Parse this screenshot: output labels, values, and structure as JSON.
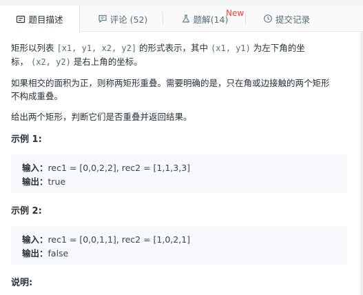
{
  "tabs": [
    {
      "label": "题目描述",
      "icon": "description-icon"
    },
    {
      "label": "评论 (52)",
      "icon": "comment-icon"
    },
    {
      "label": "题解(14)",
      "icon": "flask-icon"
    },
    {
      "label": "提交记录",
      "icon": "clock-icon"
    }
  ],
  "new_badge": "New",
  "problem": {
    "p1_a": "矩形以列表 ",
    "p1_code1": "[x1, y1, x2, y2]",
    "p1_b": " 的形式表示，其中 ",
    "p1_code2": "(x1, y1)",
    "p1_c": " 为左下角的坐",
    "p1_d": "标，",
    "p1_code3": "(x2, y2)",
    "p1_e": " 是右上角的坐标。",
    "p2_line1": "如果相交的面积为正，则称两矩形重叠。需要明确的是，只在角或边接触的两个矩形",
    "p2_line2": "不构成重叠。",
    "p3": "给出两个矩形，判断它们是否重叠并返回结果。"
  },
  "examples": [
    {
      "heading": "示例 1:",
      "input_label": "输入：",
      "input": "rec1 = [0,0,2,2], rec2 = [1,1,3,3]",
      "output_label": "输出：",
      "output": "true"
    },
    {
      "heading": "示例 2:",
      "input_label": "输入：",
      "input": "rec1 = [0,0,1,1], rec2 = [1,0,2,1]",
      "output_label": "输出：",
      "output": "false"
    }
  ],
  "notes_heading": "说明:"
}
